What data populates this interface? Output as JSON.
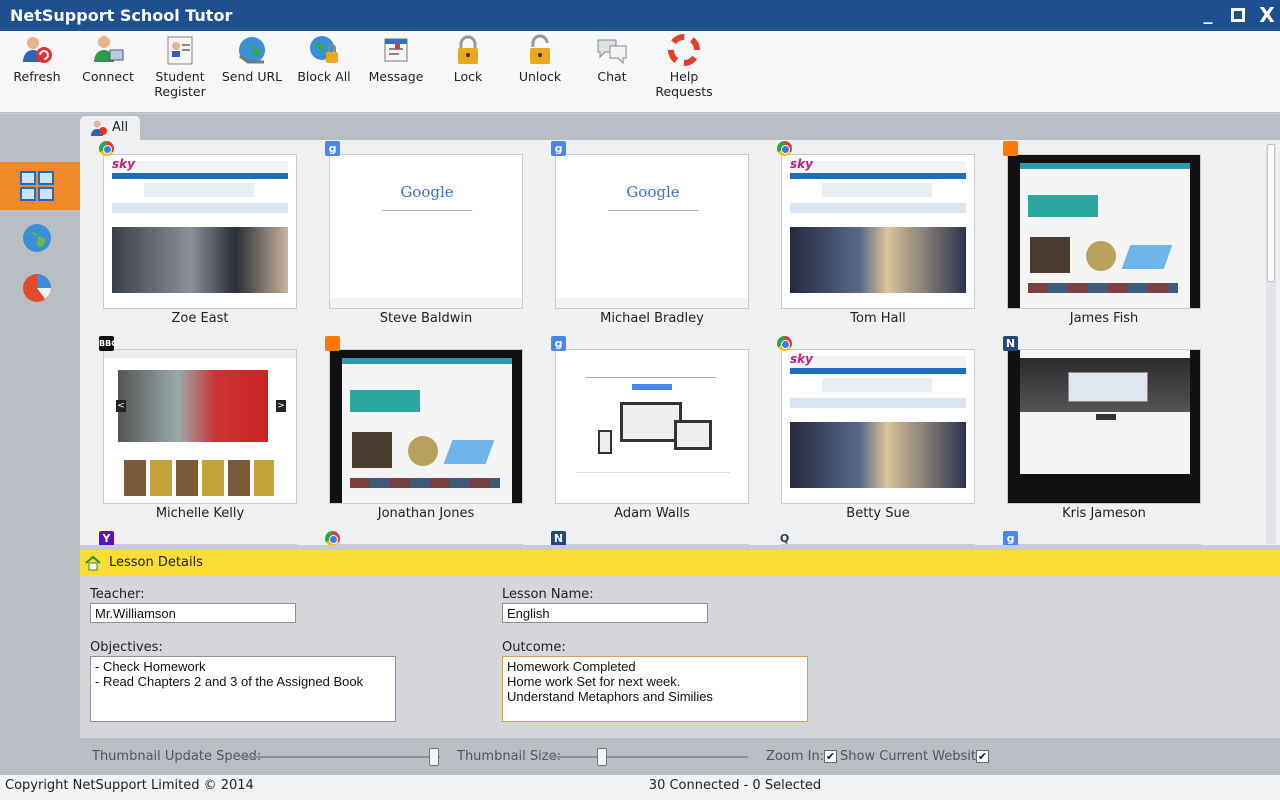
{
  "window": {
    "title": "NetSupport School Tutor",
    "min_glyph": "_",
    "close_glyph": "X"
  },
  "toolbar": {
    "buttons": [
      {
        "label": "Refresh",
        "icon": "refresh-users-icon"
      },
      {
        "label": "Connect",
        "icon": "connect-icon"
      },
      {
        "label": "Student Register",
        "icon": "student-register-icon"
      },
      {
        "label": "Send URL",
        "icon": "send-url-icon"
      },
      {
        "label": "Block All",
        "icon": "block-all-icon"
      },
      {
        "label": "Message",
        "icon": "message-icon"
      },
      {
        "label": "Lock",
        "icon": "lock-icon"
      },
      {
        "label": "Unlock",
        "icon": "unlock-icon"
      },
      {
        "label": "Chat",
        "icon": "chat-icon"
      },
      {
        "label": "Help Requests",
        "icon": "help-requests-icon"
      }
    ]
  },
  "sidebar": {
    "items": [
      "thumbnail-view-icon",
      "globe-icon",
      "pie-chart-icon"
    ],
    "active": 0
  },
  "tabs": {
    "all_label": "All"
  },
  "students": [
    {
      "name": "Zoe East",
      "badge": "chrome",
      "screen": "sky"
    },
    {
      "name": "Steve Baldwin",
      "badge": "google",
      "screen": "google"
    },
    {
      "name": "Michael Bradley",
      "badge": "google",
      "screen": "google"
    },
    {
      "name": "Tom Hall",
      "badge": "chrome",
      "screen": "sky2"
    },
    {
      "name": "James Fish",
      "badge": "orange",
      "screen": "dark"
    },
    {
      "name": "Michelle Kelly",
      "badge": "bbc",
      "screen": "bbc"
    },
    {
      "name": "Jonathan Jones",
      "badge": "orange",
      "screen": "dark"
    },
    {
      "name": "Adam Walls",
      "badge": "google",
      "screen": "devices"
    },
    {
      "name": "Betty Sue",
      "badge": "chrome",
      "screen": "sky2"
    },
    {
      "name": "Kris Jameson",
      "badge": "n",
      "screen": "netsupport"
    }
  ],
  "partial_row_badges": [
    "yahoo",
    "chrome",
    "n",
    "search",
    "google"
  ],
  "screen_text": {
    "sky_logo": "sky",
    "google_word": "Google",
    "google_badge": "g",
    "bbc_badge": "BBC",
    "n_badge": "N",
    "yahoo_badge": "Y",
    "search_badge": "Q",
    "arrow_left": "<",
    "arrow_right": ">"
  },
  "lesson": {
    "header": "Lesson Details",
    "teacher_label": "Teacher:",
    "teacher_value": "Mr.Williamson",
    "lesson_name_label": "Lesson Name:",
    "lesson_name_value": "English",
    "objectives_label": "Objectives:",
    "objectives": [
      "- Check Homework",
      "- Read Chapters 2 and 3 of the Assigned Book"
    ],
    "outcome_label": "Outcome:",
    "outcome": [
      "Homework Completed",
      "Home work Set for next week.",
      "Understand Metaphors and Similies"
    ]
  },
  "controls": {
    "update_speed_label": "Thumbnail Update Speed:",
    "update_speed_level": 0.97,
    "size_label": "Thumbnail Size:",
    "size_level": 0.27,
    "zoom_label": "Zoom In:",
    "zoom_checked": true,
    "show_site_label": "Show Current Website:",
    "show_site_checked": true,
    "check_glyph": "✔"
  },
  "status": {
    "copyright": "Copyright NetSupport Limited © 2014",
    "connection": "30 Connected - 0 Selected"
  },
  "colors": {
    "titlebar": "#1e4f8e",
    "accent": "#f08a28",
    "lesson_header": "#fcdc36"
  }
}
